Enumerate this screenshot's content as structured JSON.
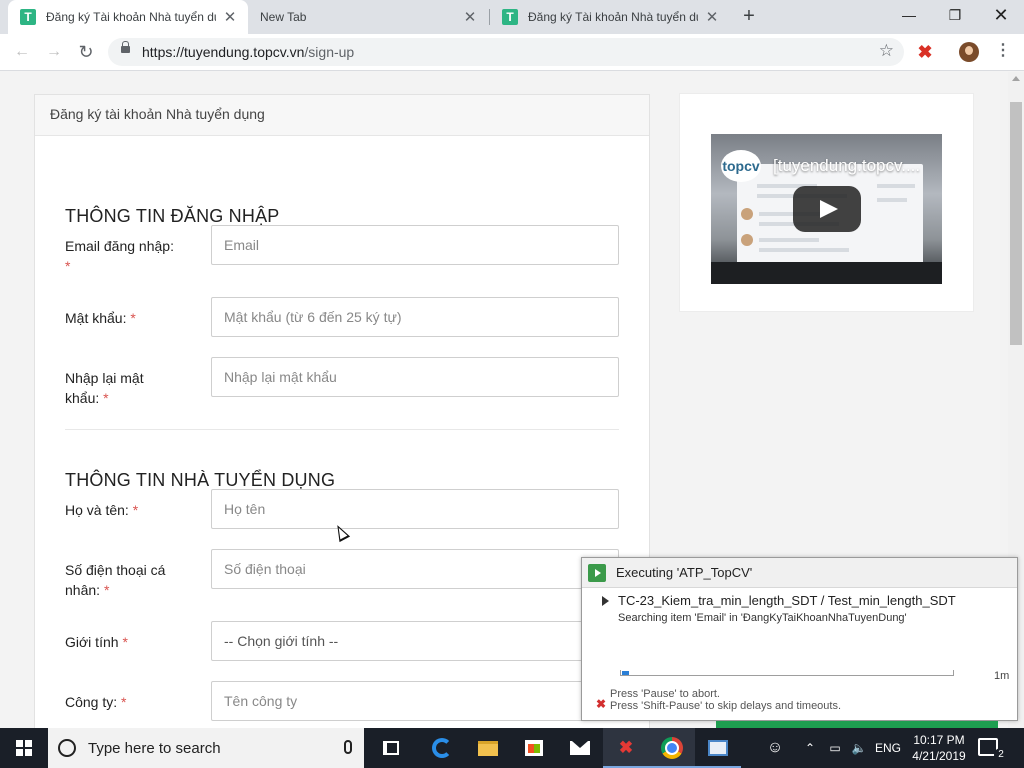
{
  "browser": {
    "tabs": [
      {
        "title": "Đăng ký Tài khoản Nhà tuyển dụ",
        "favicon": "T",
        "active": true
      },
      {
        "title": "New Tab",
        "favicon": "",
        "active": false
      },
      {
        "title": "Đăng ký Tài khoản Nhà tuyển dụ",
        "favicon": "T",
        "active": false
      }
    ],
    "url_host": "https://tuyendung.topcv.vn",
    "url_path": "/sign-up",
    "brand_color": "#2db584"
  },
  "page": {
    "card_header": "Đăng ký tài khoản Nhà tuyển dụng",
    "section_login": "THÔNG TIN ĐĂNG NHẬP",
    "section_employer": "THÔNG TIN NHÀ TUYỂN DỤNG",
    "required_mark": "*",
    "fields": {
      "email": {
        "label": "Email đăng nhập:",
        "placeholder": "Email"
      },
      "password": {
        "label": "Mật khẩu:",
        "placeholder": "Mật khẩu (từ 6 đến 25 ký tự)"
      },
      "confirm_password": {
        "label": "Nhập lại mật khẩu:",
        "placeholder": "Nhập lại mật khẩu"
      },
      "fullname": {
        "label": "Họ và tên:",
        "placeholder": "Họ tên"
      },
      "phone": {
        "label": "Số điện thoại cá nhân:",
        "placeholder": "Số điện thoại"
      },
      "gender": {
        "label": "Giới tính",
        "selected": "-- Chọn giới tính --"
      },
      "company": {
        "label": "Công ty:",
        "placeholder": "Tên công ty"
      }
    },
    "video": {
      "logo": "topcv",
      "title": "[tuyendung.topcv...."
    }
  },
  "automation_popup": {
    "title": "Executing 'ATP_TopCV'",
    "test_case": "TC-23_Kiem_tra_min_length_SDT  /  Test_min_length_SDT",
    "status": "Searching item 'Email' in 'ĐangKyTaiKhoanNhaTuyenDung'",
    "progress_fraction": 0.02,
    "elapsed": "1m",
    "hint1": "Press 'Pause' to abort.",
    "hint2": "Press 'Shift-Pause' to skip delays and timeouts."
  },
  "taskbar": {
    "search_placeholder": "Type here to search",
    "language": "ENG",
    "time": "10:17 PM",
    "date": "4/21/2019",
    "notification_count": "2"
  }
}
